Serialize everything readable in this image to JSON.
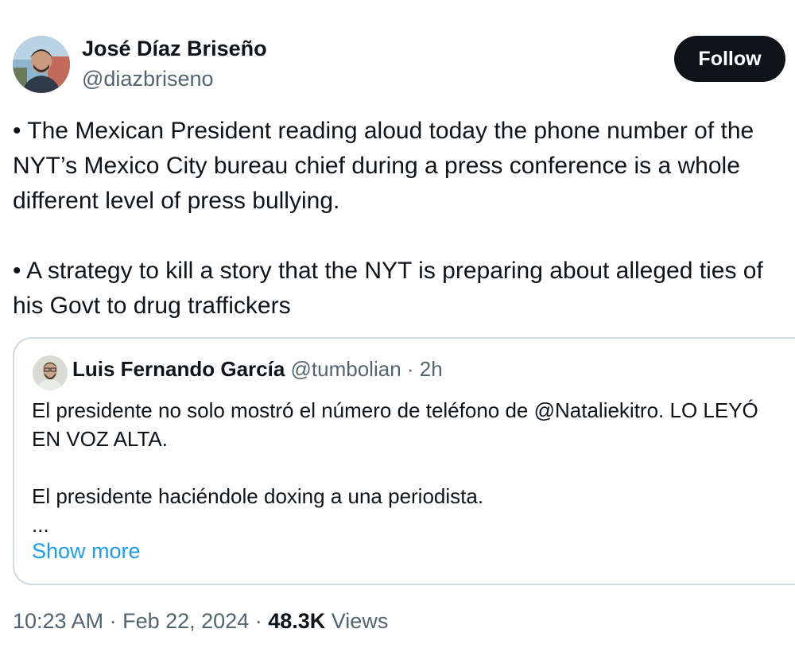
{
  "author": {
    "name": "José Díaz Briseño",
    "handle": "@diazbriseno",
    "avatar_icon": "profile-photo"
  },
  "follow_button": {
    "label": "Follow"
  },
  "tweet": {
    "lines": [
      "• The Mexican President reading aloud today the phone number of the",
      "NYT’s Mexico City bureau chief during a press conference is a whole",
      "different level of press bullying.",
      "• A strategy to kill a story that the NYT is preparing about alleged ties of",
      "his Govt to drug traffickers"
    ]
  },
  "quote": {
    "author_name": "Luis Fernando García",
    "author_handle": "@tumbolian",
    "separator": " · ",
    "time": "2h",
    "lines": [
      "El presidente no solo mostró el número de teléfono de @Nataliekitro. LO LEYÓ",
      "EN VOZ ALTA.",
      "El presidente haciéndole doxing a una periodista.",
      "..."
    ],
    "show_more": "Show more"
  },
  "meta": {
    "time": "10:23 AM",
    "sep1": " · ",
    "date": "Feb 22, 2024",
    "sep2": " · ",
    "views_count": "48.3K",
    "views_label": " Views"
  },
  "colors": {
    "text_primary": "#0f1419",
    "text_secondary": "#536471",
    "link": "#1d9bf0",
    "border": "#cfd9de",
    "button_bg": "#0f1419"
  }
}
